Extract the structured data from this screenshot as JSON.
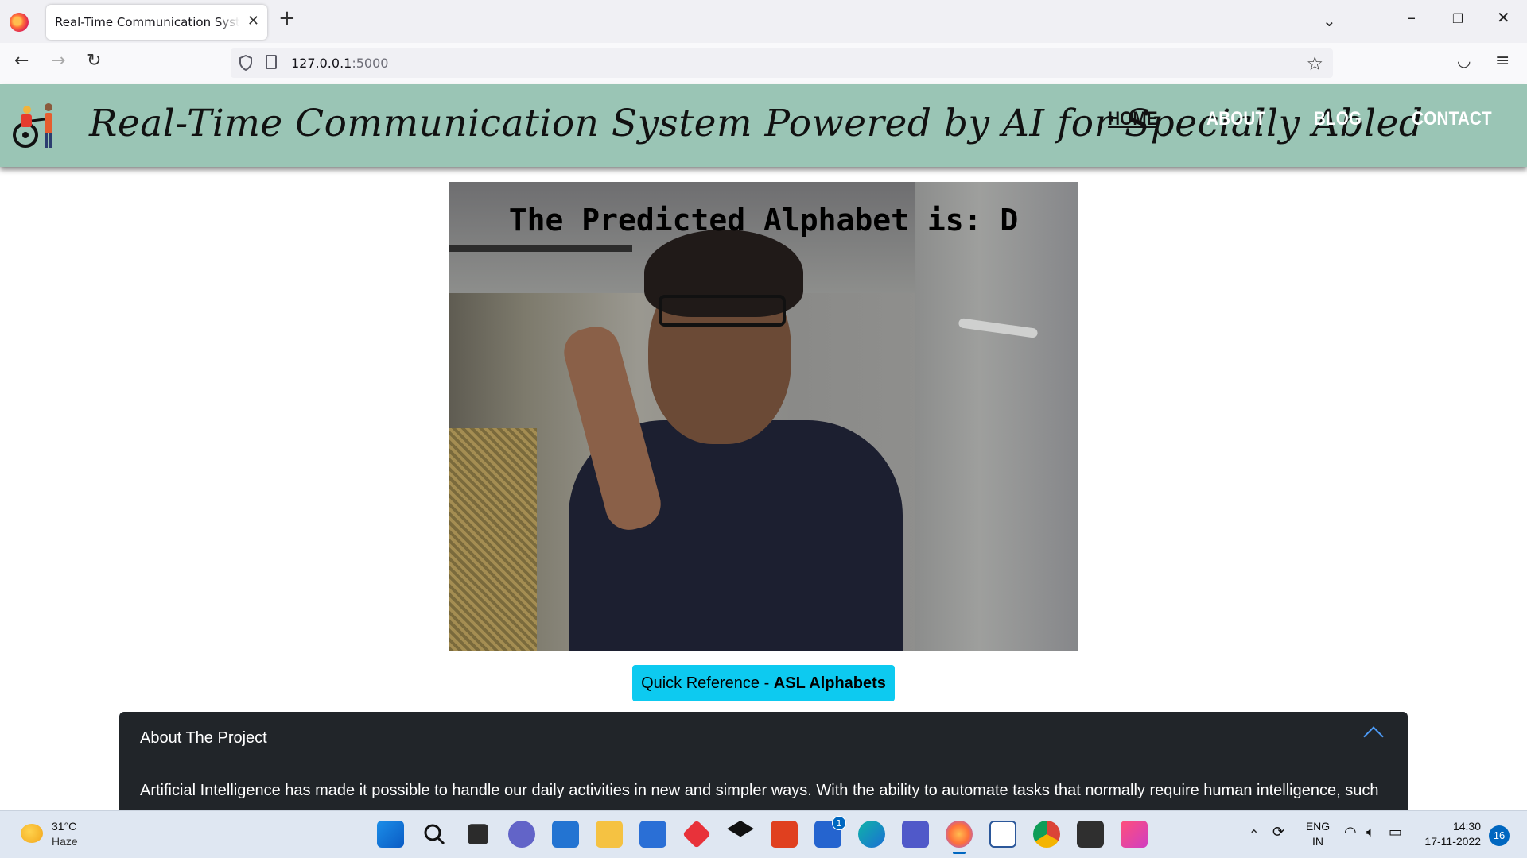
{
  "browser": {
    "tab_title": "Real-Time Communication System Powered by AI for Specially Abled",
    "url_host": "127.0.0.1",
    "url_port": ":5000",
    "icons": [
      "firefox-icon",
      "close-icon",
      "plus-icon",
      "chevron-down-icon",
      "minimize-icon",
      "restore-icon",
      "back-icon",
      "forward-icon",
      "reload-icon",
      "shield-icon",
      "page-icon",
      "star-icon",
      "pocket-icon",
      "menu-icon"
    ]
  },
  "site": {
    "title": "Real-Time Communication System Powered by AI for Specially Abled",
    "nav": [
      {
        "label": "HOME",
        "active": true
      },
      {
        "label": "ABOUT",
        "active": false
      },
      {
        "label": "BLOG",
        "active": false
      },
      {
        "label": "CONTACT",
        "active": false
      }
    ],
    "header_color": "#9ac5b5"
  },
  "video": {
    "caption": "The Predicted Alphabet is: D"
  },
  "reference_button": {
    "prefix": "Quick Reference - ",
    "bold": "ASL Alphabets",
    "color": "#0dcaf0"
  },
  "accordion": {
    "heading": "About The Project",
    "body": "Artificial Intelligence has made it possible to handle our daily activities in new and simpler ways. With the ability to automate tasks that normally require human intelligence, such"
  },
  "taskbar": {
    "weather_temp": "31°C",
    "weather_desc": "Haze",
    "apps": [
      "windows-start",
      "search",
      "task-view",
      "chat",
      "mail",
      "file-explorer",
      "microsoft-store",
      "red-app",
      "dropbox",
      "office",
      "todo",
      "edge",
      "teams",
      "firefox",
      "word",
      "chrome",
      "terminal",
      "creative-cloud"
    ],
    "todo_badge": "1",
    "lang_top": "ENG",
    "lang_bottom": "IN",
    "time": "14:30",
    "date": "17-11-2022",
    "notifications": "16"
  }
}
